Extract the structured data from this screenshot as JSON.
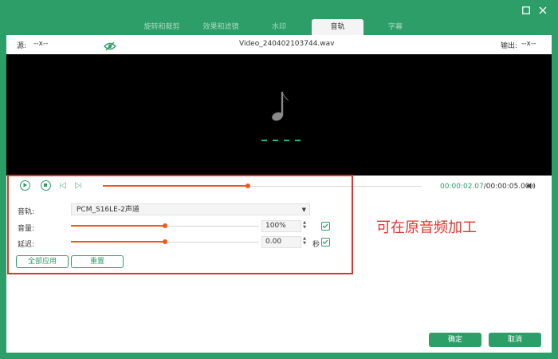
{
  "colors": {
    "accent": "#2e9e68",
    "progress": "#ec5a20",
    "annotation": "#e0322c"
  },
  "window": {
    "restore_icon": "square-icon",
    "close_icon": "close-icon"
  },
  "tabs": [
    {
      "label": "旋转和裁剪",
      "active": false
    },
    {
      "label": "效果和滤镜",
      "active": false
    },
    {
      "label": "水印",
      "active": false
    },
    {
      "label": "音轨",
      "active": true
    },
    {
      "label": "字幕",
      "active": false
    }
  ],
  "header": {
    "source_label": "源:",
    "source_value": "--x--",
    "filename": "Video_240402103744.wav",
    "output_label": "输出:",
    "output_value": "--x--"
  },
  "player": {
    "progress": 0.52,
    "current_time": "00:00:02.07",
    "total_time": "00:00:05.00",
    "time_sep": "/"
  },
  "audio": {
    "track_label": "音轨:",
    "track_value": "PCM_S16LE-2声道",
    "volume_label": "音量:",
    "volume_value": "100%",
    "volume_level": 0.5,
    "delay_label": "延迟:",
    "delay_value": "0.00",
    "delay_unit": "秒",
    "delay_level": 0.5,
    "apply_all_label": "全部应用",
    "reset_label": "重置"
  },
  "annotation": "可在原音频加工",
  "footer": {
    "ok_label": "确定",
    "cancel_label": "取消"
  }
}
